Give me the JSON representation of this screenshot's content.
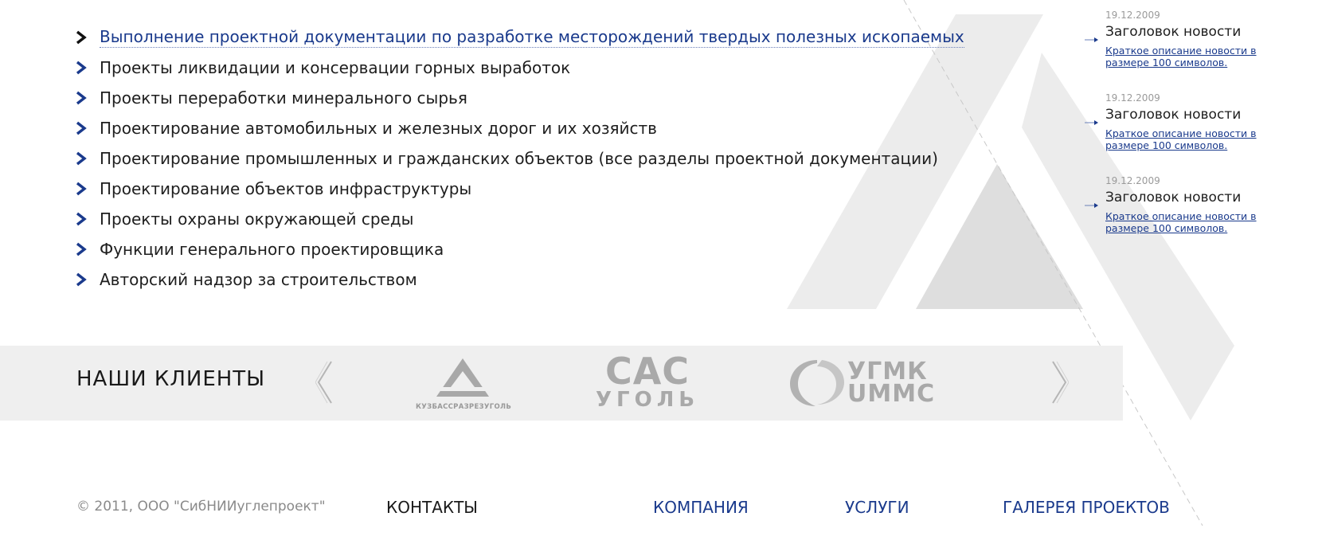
{
  "services": {
    "items": [
      {
        "label": "Выполнение проектной документации по разработке месторождений твердых полезных ископаемых",
        "active": true
      },
      {
        "label": "Проекты ликвидации и консервации горных выработок"
      },
      {
        "label": "Проекты переработки минерального сырья"
      },
      {
        "label": "Проектирование автомобильных и железных дорог и их хозяйств"
      },
      {
        "label": "Проектирование промышленных и гражданских объектов (все разделы проектной документации)"
      },
      {
        "label": "Проектирование объектов инфраструктуры"
      },
      {
        "label": "Проекты охраны окружающей среды"
      },
      {
        "label": "Функции генерального проектировщика"
      },
      {
        "label": "Авторский надзор за строительством"
      }
    ]
  },
  "news": [
    {
      "date": "19.12.2009",
      "title": "Заголовок новости",
      "desc": "Краткое описание новости в размере 100 символов."
    },
    {
      "date": "19.12.2009",
      "title": "Заголовок новости",
      "desc": "Краткое описание новости в размере 100 символов."
    },
    {
      "date": "19.12.2009",
      "title": "Заголовок новости",
      "desc": "Краткое описание новости в размере 100 символов."
    }
  ],
  "clients": {
    "title": "НАШИ КЛИЕНТЫ",
    "logos": [
      {
        "name": "КУЗБАССРАЗРЕЗУГОЛЬ"
      },
      {
        "line1": "САС",
        "line2": "УГОЛЬ"
      },
      {
        "line1": "УГМК",
        "line2": "UMMC"
      }
    ]
  },
  "footer": {
    "copyright": "© 2011, ООО \"СибНИИуглепроект\"",
    "links": [
      {
        "label": "КОНТАКТЫ",
        "color": "#1a1a1a"
      },
      {
        "label": "КОМПАНИЯ",
        "color": "#1a3a8c"
      },
      {
        "label": "УСЛУГИ",
        "color": "#1a3a8c"
      },
      {
        "label": "ГАЛЕРЕЯ ПРОЕКТОВ",
        "color": "#1a3a8c"
      }
    ]
  },
  "colors": {
    "accent": "#1a3a8c",
    "band": "#efefef",
    "art": "#ebebeb"
  }
}
